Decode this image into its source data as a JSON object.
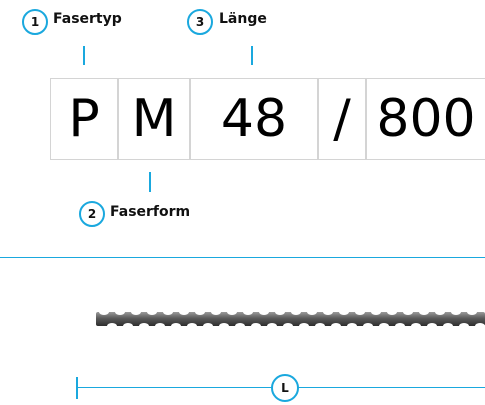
{
  "code": {
    "cells": [
      "P",
      "M",
      "48",
      "/",
      "800"
    ]
  },
  "callouts": [
    {
      "number": "1",
      "label": "Fasertyp"
    },
    {
      "number": "2",
      "label": "Faserform"
    },
    {
      "number": "3",
      "label": "Länge"
    }
  ],
  "dimension": {
    "label": "L"
  },
  "colors": {
    "accent": "#1aa8de",
    "cell_border": "#d4d4d4",
    "fiber": "#6e6e6e"
  }
}
